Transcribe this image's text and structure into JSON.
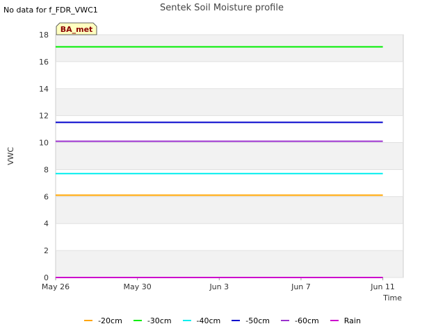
{
  "note": "No data for f_FDR_VWC1",
  "badge": "BA_met",
  "colors": {
    "-20cm": "#ffa500",
    "-30cm": "#00ee00",
    "-40cm": "#00eeee",
    "-50cm": "#0000cc",
    "-60cm": "#9a32cd",
    "Rain": "#cc00cc"
  },
  "chart_data": {
    "type": "line",
    "title": "Sentek Soil Moisture profile",
    "xlabel": "Time",
    "ylabel": "VWC",
    "ylim": [
      0,
      18
    ],
    "yticks": [
      0,
      2,
      4,
      6,
      8,
      10,
      12,
      14,
      16,
      18
    ],
    "xlim": [
      "2024-05-26",
      "2024-06-12"
    ],
    "xticks": [
      {
        "date": "2024-05-26",
        "label": "May 26"
      },
      {
        "date": "2024-05-30",
        "label": "May 30"
      },
      {
        "date": "2024-06-03",
        "label": "Jun 3"
      },
      {
        "date": "2024-06-07",
        "label": "Jun 7"
      },
      {
        "date": "2024-06-11",
        "label": "Jun 11"
      }
    ],
    "x": [
      "2024-05-26",
      "2024-06-11"
    ],
    "grid": true,
    "legend": "bottom",
    "series": [
      {
        "name": "-20cm",
        "values": [
          6.1,
          6.1
        ]
      },
      {
        "name": "-30cm",
        "values": [
          17.1,
          17.1
        ]
      },
      {
        "name": "-40cm",
        "values": [
          7.7,
          7.7
        ]
      },
      {
        "name": "-50cm",
        "values": [
          11.5,
          11.5
        ]
      },
      {
        "name": "-60cm",
        "values": [
          10.1,
          10.1
        ]
      },
      {
        "name": "Rain",
        "values": [
          0,
          0
        ]
      }
    ]
  }
}
